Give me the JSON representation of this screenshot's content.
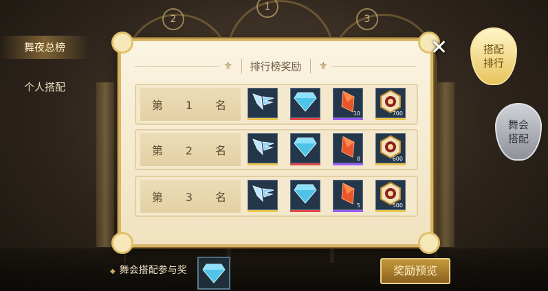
{
  "left_tabs": [
    "舞夜总榜",
    "个人搭配"
  ],
  "right_buttons": [
    "搭配排行",
    "舞会搭配"
  ],
  "top_markers": [
    "2",
    "1",
    "3"
  ],
  "dialog": {
    "title": "排行榜奖励",
    "close": "✕",
    "rows": [
      {
        "rank_label": "第 1 名",
        "items": [
          {
            "icon": "wing-icon",
            "qty": ""
          },
          {
            "icon": "diamond-icon",
            "qty": ""
          },
          {
            "icon": "red-crystal-icon",
            "qty": "10"
          },
          {
            "icon": "medal-badge-icon",
            "qty": "700"
          }
        ]
      },
      {
        "rank_label": "第 2 名",
        "items": [
          {
            "icon": "wing-icon",
            "qty": ""
          },
          {
            "icon": "diamond-icon",
            "qty": ""
          },
          {
            "icon": "red-crystal-icon",
            "qty": "8"
          },
          {
            "icon": "medal-badge-icon",
            "qty": "600"
          }
        ]
      },
      {
        "rank_label": "第 3 名",
        "items": [
          {
            "icon": "wing-icon",
            "qty": ""
          },
          {
            "icon": "diamond-icon",
            "qty": ""
          },
          {
            "icon": "red-crystal-icon",
            "qty": "5"
          },
          {
            "icon": "medal-badge-icon",
            "qty": "500"
          }
        ]
      }
    ]
  },
  "bottom": {
    "participation_label": "舞会搭配参与奖",
    "preview_button": "奖励预览"
  },
  "colors": {
    "accent_gold": "#d7b567",
    "panel": "#f4e8cc",
    "item_bg": "#24364a"
  }
}
